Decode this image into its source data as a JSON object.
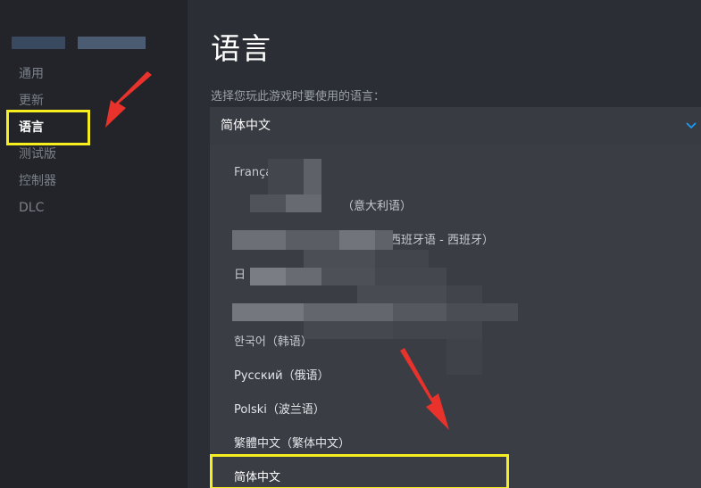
{
  "sidebar": {
    "items": [
      {
        "label": "通用"
      },
      {
        "label": "更新"
      },
      {
        "label": "语言"
      },
      {
        "label": "测试版"
      },
      {
        "label": "控制器"
      },
      {
        "label": "DLC"
      }
    ]
  },
  "main": {
    "title": "语言",
    "prompt": "选择您玩此游戏时要使用的语言：",
    "select_value": "简体中文"
  },
  "dropdown": {
    "options": [
      {
        "label": "Français"
      },
      {
        "label": "（意大利语）"
      },
      {
        "label": "（西班牙语 - 西班牙）"
      },
      {
        "label": "日"
      },
      {
        "label": ""
      },
      {
        "label": "한국어（韩语）"
      },
      {
        "label": "Русский（俄语）"
      },
      {
        "label": "Polski（波兰语）"
      },
      {
        "label": "繁體中文（繁体中文）"
      },
      {
        "label": "简体中文"
      }
    ]
  },
  "colors": {
    "highlight": "#f6ee1f",
    "arrow": "#e8322b",
    "accent": "#1a9fff"
  },
  "icons": [
    "chevron-down-icon",
    "red-arrow-icon"
  ]
}
